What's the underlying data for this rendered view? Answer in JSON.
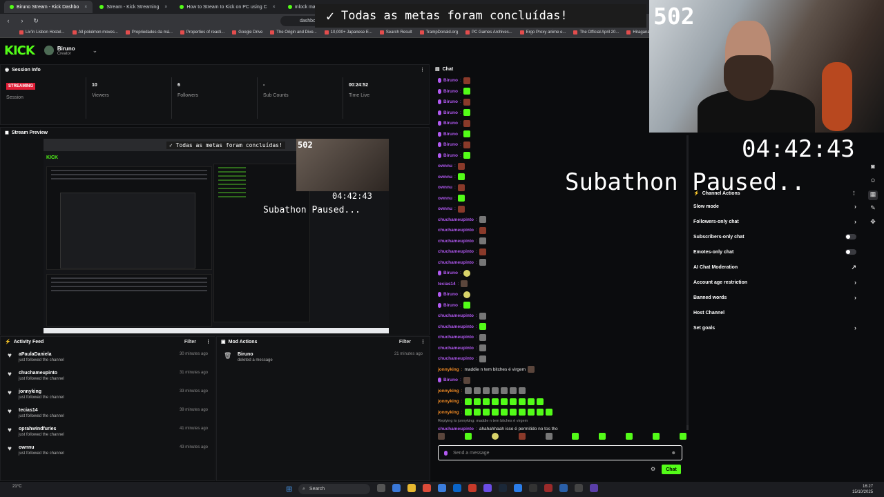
{
  "browser": {
    "tabs": [
      {
        "label": "Biruno Stream - Kick Dashbo",
        "active": true
      },
      {
        "label": "Stream - Kick Streaming",
        "active": false
      },
      {
        "label": "How to Stream to Kick on PC using C",
        "active": false
      },
      {
        "label": "mlock max birrano - Pesqui",
        "active": false
      }
    ],
    "url": "dashboard.kick.com/",
    "bookmarks": [
      "Liv'in Lisbon Hostel...",
      "All pokémon moves...",
      "Propriedades da má...",
      "Properties of reacti...",
      "Google Drive",
      "The Origin and Dive...",
      "10,000+ Japanese E...",
      "Search Result",
      "TrampDonald.org",
      "PC Games Archives...",
      "Ergo Proxy anime e...",
      "The Official April 20...",
      "Hiragana le"
    ]
  },
  "header": {
    "logo": "KICK",
    "channel_name": "Biruno",
    "channel_role": "Creator"
  },
  "session": {
    "title": "Session Info",
    "stats": [
      {
        "value": "STREAMING",
        "label": "Session"
      },
      {
        "value": "10",
        "label": "Viewers"
      },
      {
        "value": "6",
        "label": "Followers"
      },
      {
        "value": "-",
        "label": "Sub Counts"
      },
      {
        "value": "00:24:52",
        "label": "Time Live"
      }
    ]
  },
  "preview": {
    "title": "Stream Preview",
    "banner": "Todas as metas foram concluídas!",
    "counter": "502",
    "clock": "04:42:43",
    "paused": "Subathon Paused..."
  },
  "activity": {
    "title": "Activity Feed",
    "filter": "Filter",
    "items": [
      {
        "user": "aPaulaDaniela",
        "desc": "just followed the channel",
        "time": "30 minutes ago"
      },
      {
        "user": "chuchameupinto",
        "desc": "just followed the channel",
        "time": "31 minutes ago"
      },
      {
        "user": "jonnyking",
        "desc": "just followed the channel",
        "time": "33 minutes ago"
      },
      {
        "user": "tecias14",
        "desc": "just followed the channel",
        "time": "39 minutes ago"
      },
      {
        "user": "oprahwindfuries",
        "desc": "just followed the channel",
        "time": "41 minutes ago"
      },
      {
        "user": "ownnu",
        "desc": "just followed the channel",
        "time": "43 minutes ago"
      }
    ]
  },
  "mod_actions": {
    "title": "Mod Actions",
    "filter": "Filter",
    "items": [
      {
        "user": "Biruno",
        "desc": "deleted a message",
        "time": "21 minutes ago"
      }
    ]
  },
  "chat": {
    "title": "Chat",
    "messages": [
      {
        "user": "Biruno",
        "color": "#b259f2",
        "badge": true,
        "text": "",
        "emotes": [
          "red"
        ]
      },
      {
        "user": "Biruno",
        "color": "#b259f2",
        "badge": true,
        "text": "",
        "emotes": [
          "green"
        ]
      },
      {
        "user": "Biruno",
        "color": "#b259f2",
        "badge": true,
        "text": "",
        "emotes": [
          "red"
        ]
      },
      {
        "user": "Biruno",
        "color": "#b259f2",
        "badge": true,
        "text": "",
        "emotes": [
          "green"
        ]
      },
      {
        "user": "Biruno",
        "color": "#b259f2",
        "badge": true,
        "text": "",
        "emotes": [
          "red"
        ]
      },
      {
        "user": "Biruno",
        "color": "#b259f2",
        "badge": true,
        "text": "",
        "emotes": [
          "green"
        ]
      },
      {
        "user": "Biruno",
        "color": "#b259f2",
        "badge": true,
        "text": "",
        "emotes": [
          "red"
        ]
      },
      {
        "user": "Biruno",
        "color": "#b259f2",
        "badge": true,
        "text": "",
        "emotes": [
          "green"
        ]
      },
      {
        "user": "ownnu",
        "color": "#b259f2",
        "badge": false,
        "text": "",
        "emotes": [
          "red"
        ]
      },
      {
        "user": "ownnu",
        "color": "#b259f2",
        "badge": false,
        "text": "",
        "emotes": [
          "green"
        ]
      },
      {
        "user": "ownnu",
        "color": "#b259f2",
        "badge": false,
        "text": "",
        "emotes": [
          "red"
        ]
      },
      {
        "user": "ownnu",
        "color": "#b259f2",
        "badge": false,
        "text": "",
        "emotes": [
          "green"
        ]
      },
      {
        "user": "ownnu",
        "color": "#b259f2",
        "badge": false,
        "text": "",
        "emotes": [
          "red"
        ]
      },
      {
        "user": "chuchameupinto",
        "color": "#b259f2",
        "badge": false,
        "text": "",
        "emotes": [
          "gray"
        ]
      },
      {
        "user": "chuchameupinto",
        "color": "#b259f2",
        "badge": false,
        "text": "",
        "emotes": [
          "red"
        ]
      },
      {
        "user": "chuchameupinto",
        "color": "#b259f2",
        "badge": false,
        "text": "",
        "emotes": [
          "gray"
        ]
      },
      {
        "user": "chuchameupinto",
        "color": "#b259f2",
        "badge": false,
        "text": "",
        "emotes": [
          "red"
        ]
      },
      {
        "user": "chuchameupinto",
        "color": "#b259f2",
        "badge": false,
        "text": "",
        "emotes": [
          "gray"
        ]
      },
      {
        "user": "Biruno",
        "color": "#b259f2",
        "badge": true,
        "text": "",
        "emotes": [
          "yel"
        ]
      },
      {
        "user": "tecias14",
        "color": "#b259f2",
        "badge": false,
        "text": "",
        "emotes": [
          "pic"
        ]
      },
      {
        "user": "Biruno",
        "color": "#b259f2",
        "badge": true,
        "text": "",
        "emotes": [
          "yel"
        ]
      },
      {
        "user": "Biruno",
        "color": "#b259f2",
        "badge": true,
        "text": "",
        "emotes": [
          "green"
        ]
      },
      {
        "user": "chuchameupinto",
        "color": "#b259f2",
        "badge": false,
        "text": "",
        "emotes": [
          "gray"
        ]
      },
      {
        "user": "chuchameupinto",
        "color": "#b259f2",
        "badge": false,
        "text": "",
        "emotes": [
          "green"
        ]
      },
      {
        "user": "chuchameupinto",
        "color": "#b259f2",
        "badge": false,
        "text": "",
        "emotes": [
          "gray"
        ]
      },
      {
        "user": "chuchameupinto",
        "color": "#b259f2",
        "badge": false,
        "text": "",
        "emotes": [
          "gray"
        ]
      },
      {
        "user": "chuchameupinto",
        "color": "#b259f2",
        "badge": false,
        "text": "",
        "emotes": [
          "gray"
        ]
      },
      {
        "user": "jonnyking",
        "color": "#f08a24",
        "badge": false,
        "text": "maddie n tem bitches é virgem",
        "emotes": [
          "pic"
        ]
      },
      {
        "user": "Biruno",
        "color": "#b259f2",
        "badge": true,
        "text": "",
        "emotes": [
          "pic"
        ]
      },
      {
        "user": "jonnyking",
        "color": "#f08a24",
        "badge": false,
        "text": "",
        "emotes": [
          "gray",
          "gray",
          "gray",
          "gray",
          "gray",
          "gray",
          "gray"
        ]
      },
      {
        "user": "jonnyking",
        "color": "#f08a24",
        "badge": false,
        "text": "",
        "emotes": [
          "green",
          "green",
          "green",
          "green",
          "green",
          "green",
          "green",
          "green",
          "green"
        ]
      },
      {
        "user": "jonnyking",
        "color": "#f08a24",
        "badge": false,
        "text": "",
        "emotes": [
          "green",
          "green",
          "green",
          "green",
          "green",
          "green",
          "green",
          "green",
          "green",
          "green"
        ]
      }
    ],
    "reply_context": "Replying to jonnyking: maddie n tem bitches é virgem",
    "last_message": {
      "user": "chuchameupinto",
      "text": "ahahahhaah isso é permitido no tos tho"
    },
    "input_placeholder": "Send a message",
    "send_label": "Chat"
  },
  "overlay": {
    "banner": "Todas as metas foram concluídas!",
    "counter": "502",
    "clock": "04:42:43",
    "paused": "Subathon Paused.."
  },
  "channel_actions": {
    "title": "Channel Actions",
    "items": [
      {
        "label": "Slow mode",
        "control": "chevron"
      },
      {
        "label": "Followers-only chat",
        "control": "chevron"
      },
      {
        "label": "Subscribers-only chat",
        "control": "toggle"
      },
      {
        "label": "Emotes-only chat",
        "control": "toggle"
      },
      {
        "label": "AI Chat Moderation",
        "control": "link"
      },
      {
        "label": "Account age restriction",
        "control": "chevron"
      },
      {
        "label": "Banned words",
        "control": "chevron"
      },
      {
        "label": "Host Channel",
        "control": "none"
      },
      {
        "label": "Set goals",
        "control": "chevron"
      }
    ]
  },
  "taskbar": {
    "weather": "21°C",
    "search": "Search",
    "time": "16:27",
    "date": "15/10/2025"
  },
  "colors": {
    "kick_green": "#53fc18",
    "live_red": "#e01e37",
    "mod_purple": "#b259f2"
  }
}
